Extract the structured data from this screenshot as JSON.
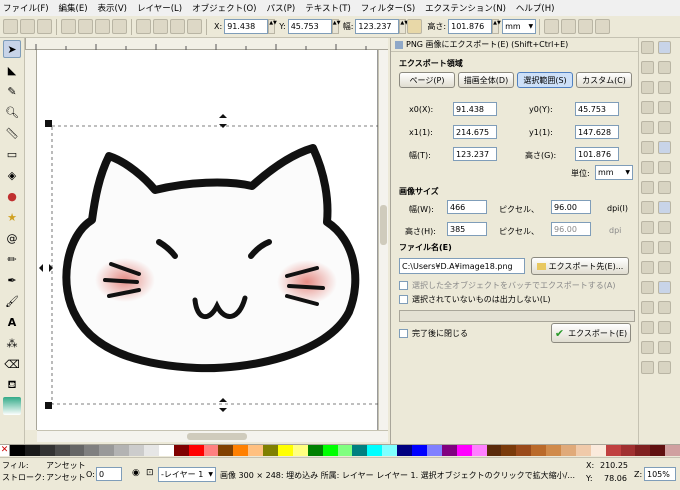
{
  "menu": [
    "ファイル(F)",
    "編集(E)",
    "表示(V)",
    "レイヤー(L)",
    "オブジェクト(O)",
    "パス(P)",
    "テキスト(T)",
    "フィルター(S)",
    "エクステンション(N)",
    "ヘルプ(H)"
  ],
  "toolbar": {
    "x_label": "X:",
    "x": "91.438",
    "y_label": "Y:",
    "y": "45.753",
    "w_label": "幅:",
    "w": "123.237",
    "h_label": "高さ:",
    "h": "101.876",
    "unit": "mm"
  },
  "dialog": {
    "title": "PNG 画像にエクスポート(E) (Shift+Ctrl+E)",
    "area_heading": "エクスポート領域",
    "area_buttons": [
      "ページ(P)",
      "描画全体(D)",
      "選択範囲(S)",
      "カスタム(C)"
    ],
    "x0_label": "x0(X):",
    "x0": "91.438",
    "y0_label": "y0(Y):",
    "y0": "45.753",
    "x1_label": "x1(1):",
    "x1": "214.675",
    "y1_label": "y1(1):",
    "y1": "147.628",
    "width_label": "幅(T):",
    "width": "123.237",
    "height_label": "高さ(G):",
    "height": "101.876",
    "unit_label": "単位:",
    "unit": "mm",
    "size_heading": "画像サイズ",
    "px_width_label": "幅(W):",
    "px_width": "466",
    "px_unit": "ピクセル、",
    "dpi_value": "96.00",
    "dpi_unit": "dpi(I)",
    "px_height_label": "高さ(H):",
    "px_height": "385",
    "dpi_value2": "96.00",
    "dpi_unit2": "dpi",
    "filename_heading": "ファイル名(E)",
    "filename": "C:\\Users¥D.A¥image18.png",
    "export_as": "エクスポート先(E)...",
    "batch": "選択した全オブジェクトをバッチでエクスポートする(A)",
    "hide": "選択されていないものは出力しない(L)",
    "close_after": "完了後に閉じる",
    "export": "エクスポート(E)"
  },
  "status": {
    "fill_label": "フィル:",
    "fill_value": "アンセット",
    "stroke_label": "ストローク:",
    "stroke_value": "アンセット",
    "opacity_label": "O:",
    "opacity": "0",
    "layer": "-レイヤー 1",
    "message": "画像 300 × 248: 埋め込み 所属: レイヤー レイヤー 1. 選択オブジェクトのクリックで拡大縮小/...",
    "x_label": "X:",
    "x": "210.25",
    "y_label": "Y:",
    "y": "78.06",
    "zoom_label": "Z:",
    "zoom": "105%"
  }
}
